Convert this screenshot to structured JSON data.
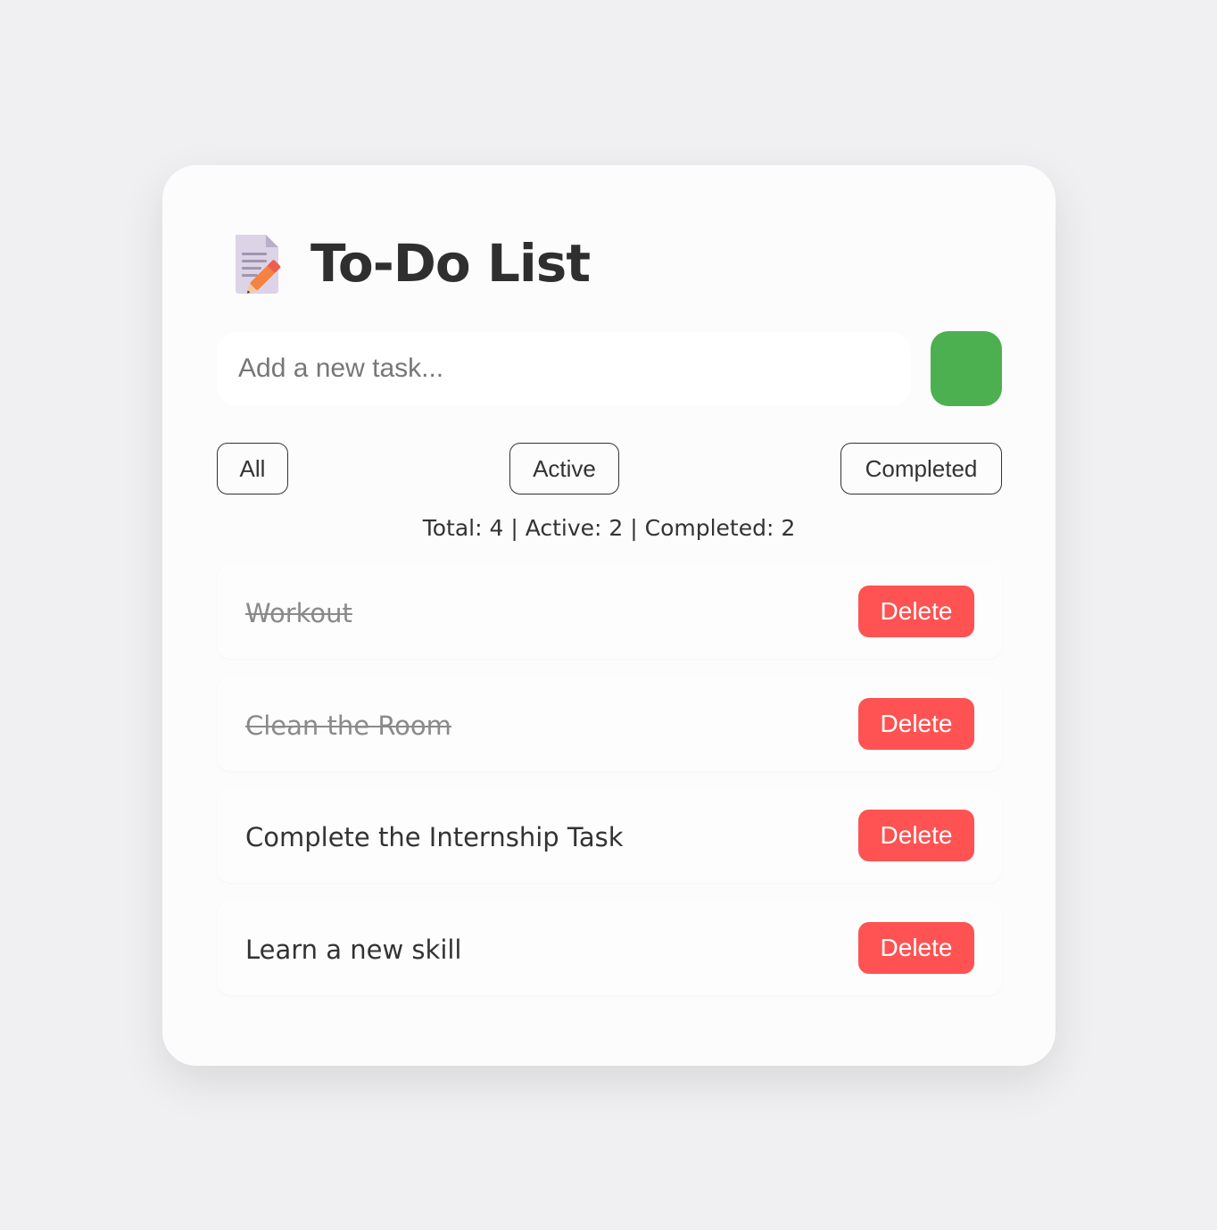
{
  "app": {
    "title": "To-Do List",
    "icon": "memo-icon"
  },
  "input": {
    "placeholder": "Add a new task...",
    "value": "",
    "add_button_color": "#4caf50"
  },
  "filters": {
    "all": "All",
    "active": "Active",
    "completed": "Completed"
  },
  "stats": {
    "text": "Total: 4 | Active: 2 | Completed: 2"
  },
  "tasks": [
    {
      "text": "Workout",
      "completed": true,
      "delete_label": "Delete"
    },
    {
      "text": "Clean the Room",
      "completed": true,
      "delete_label": "Delete"
    },
    {
      "text": "Complete the Internship Task",
      "completed": false,
      "delete_label": "Delete"
    },
    {
      "text": "Learn a new skill",
      "completed": false,
      "delete_label": "Delete"
    }
  ],
  "colors": {
    "background": "#f0f0f2",
    "card": "#fcfcfc",
    "delete": "#ff5252",
    "add": "#4caf50"
  }
}
